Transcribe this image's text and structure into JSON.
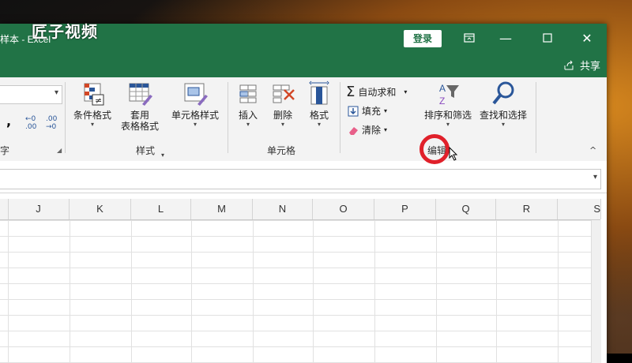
{
  "watermark": "匠子视频",
  "title": "样本 - Excel",
  "login_label": "登录",
  "share_label": "共享",
  "ribbon": {
    "conditional_format": "条件格式",
    "table_format": "套用",
    "table_format_2": "表格格式",
    "cell_style": "单元格样式",
    "styles_group": "样式",
    "insert": "插入",
    "delete": "删除",
    "format": "格式",
    "cells_group": "单元格",
    "autosum": "自动求和",
    "fill": "填充",
    "clear": "清除",
    "sort_filter": "排序和筛选",
    "find_select": "查找和选择",
    "edit_group": "编辑",
    "number_group_partial": "字",
    "comma": ",",
    "dec_increase": "←0 .00",
    "dec_decrease": ".00 →0"
  },
  "columns": [
    "J",
    "K",
    "L",
    "M",
    "N",
    "O",
    "P",
    "Q",
    "R",
    "S"
  ]
}
